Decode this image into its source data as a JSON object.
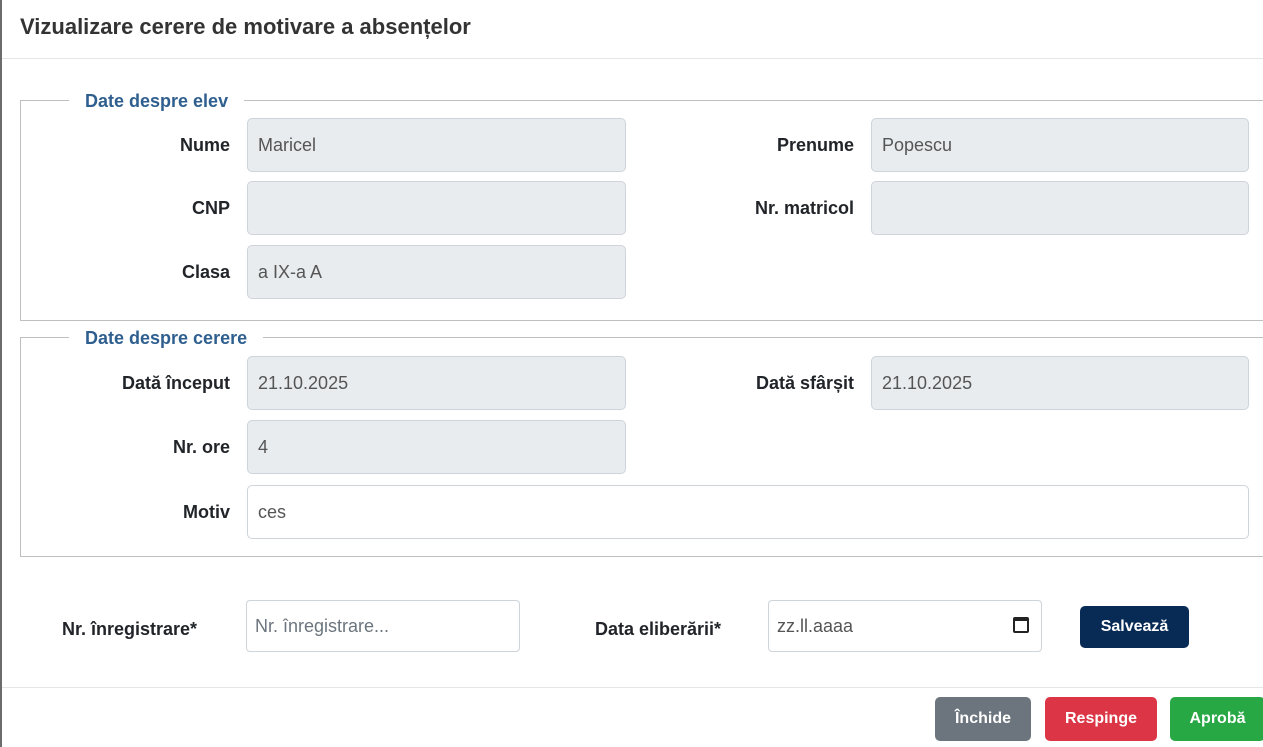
{
  "modal": {
    "title": "Vizualizare cerere de motivare a absențelor"
  },
  "elev": {
    "legend": "Date despre elev",
    "nume_label": "Nume",
    "nume_value": "Maricel",
    "prenume_label": "Prenume",
    "prenume_value": "Popescu",
    "cnp_label": "CNP",
    "cnp_value": "",
    "matricol_label": "Nr. matricol",
    "matricol_value": "",
    "clasa_label": "Clasa",
    "clasa_value": "a IX-a A"
  },
  "cerere": {
    "legend": "Date despre cerere",
    "inceput_label": "Dată început",
    "inceput_value": "21.10.2025",
    "sfarsit_label": "Dată sfârșit",
    "sfarsit_value": "21.10.2025",
    "ore_label": "Nr. ore",
    "ore_value": "4",
    "motiv_label": "Motiv",
    "motiv_value": "ces"
  },
  "inregistrare": {
    "nr_label": "Nr. înregistrare*",
    "nr_placeholder": "Nr. înregistrare...",
    "data_label": "Data eliberării*",
    "data_placeholder": "zz.ll.aaaa",
    "calendar_icon": "calendar-icon",
    "save_label": "Salvează"
  },
  "footer": {
    "close_label": "Închide",
    "reject_label": "Respinge",
    "approve_label": "Aprobă"
  },
  "colors": {
    "legend": "#2f5f8f",
    "save": "#082b56",
    "close": "#6c757d",
    "reject": "#dc3545",
    "approve": "#28a745"
  }
}
